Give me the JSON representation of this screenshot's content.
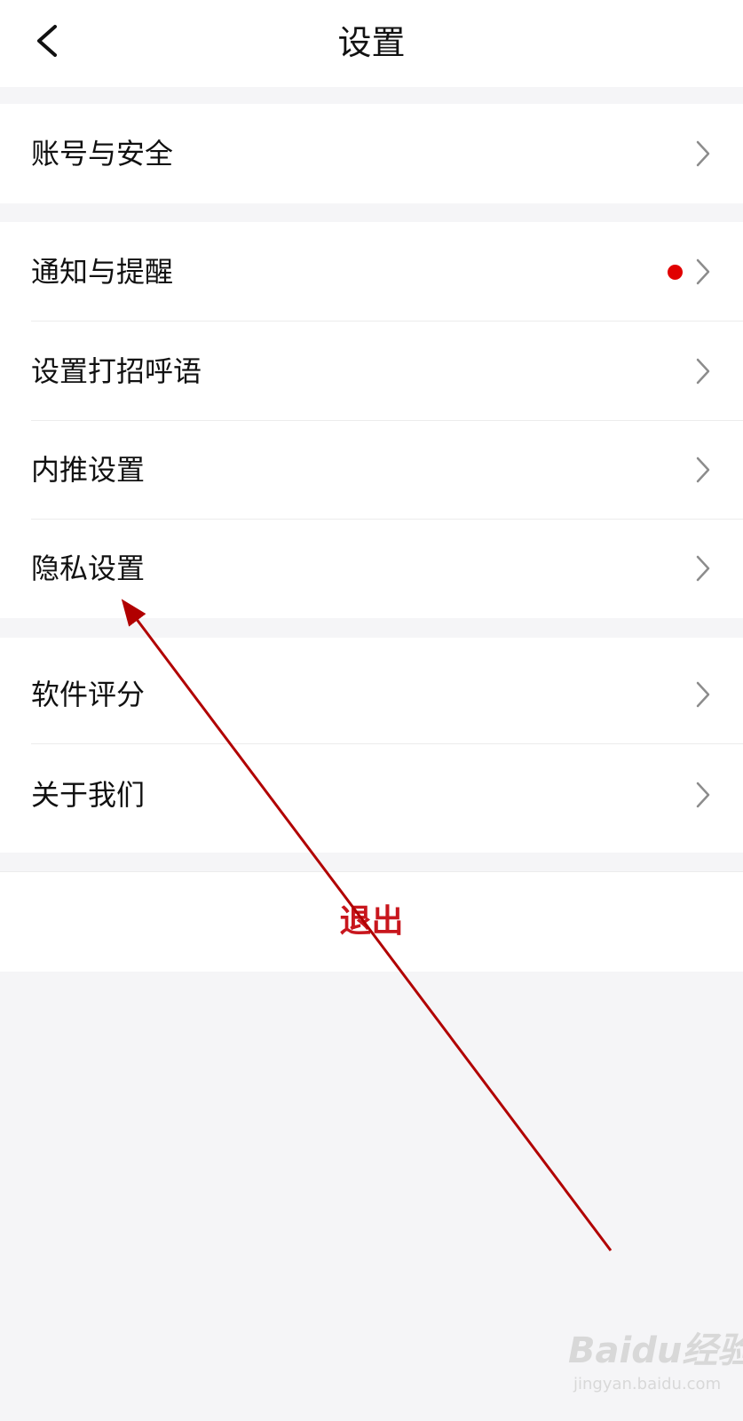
{
  "header": {
    "back_icon": "chevron-left-icon",
    "title": "设置"
  },
  "groups": [
    {
      "items": [
        {
          "label": "账号与安全",
          "has_dot": false
        }
      ]
    },
    {
      "items": [
        {
          "label": "通知与提醒",
          "has_dot": true
        },
        {
          "label": "设置打招呼语",
          "has_dot": false
        },
        {
          "label": "内推设置",
          "has_dot": false
        },
        {
          "label": "隐私设置",
          "has_dot": false
        }
      ]
    },
    {
      "items": [
        {
          "label": "软件评分",
          "has_dot": false
        },
        {
          "label": "关于我们",
          "has_dot": false
        }
      ]
    }
  ],
  "logout": {
    "label": "退出"
  },
  "colors": {
    "background": "#f5f5f7",
    "card": "#ffffff",
    "text": "#111111",
    "logout_text": "#c8161d",
    "notification_dot": "#e10000",
    "annotation_arrow": "#b10000",
    "chevron": "#8c8c8c"
  },
  "watermark": {
    "brand": "Baidu经验",
    "site": "jingyan.baidu.com"
  }
}
